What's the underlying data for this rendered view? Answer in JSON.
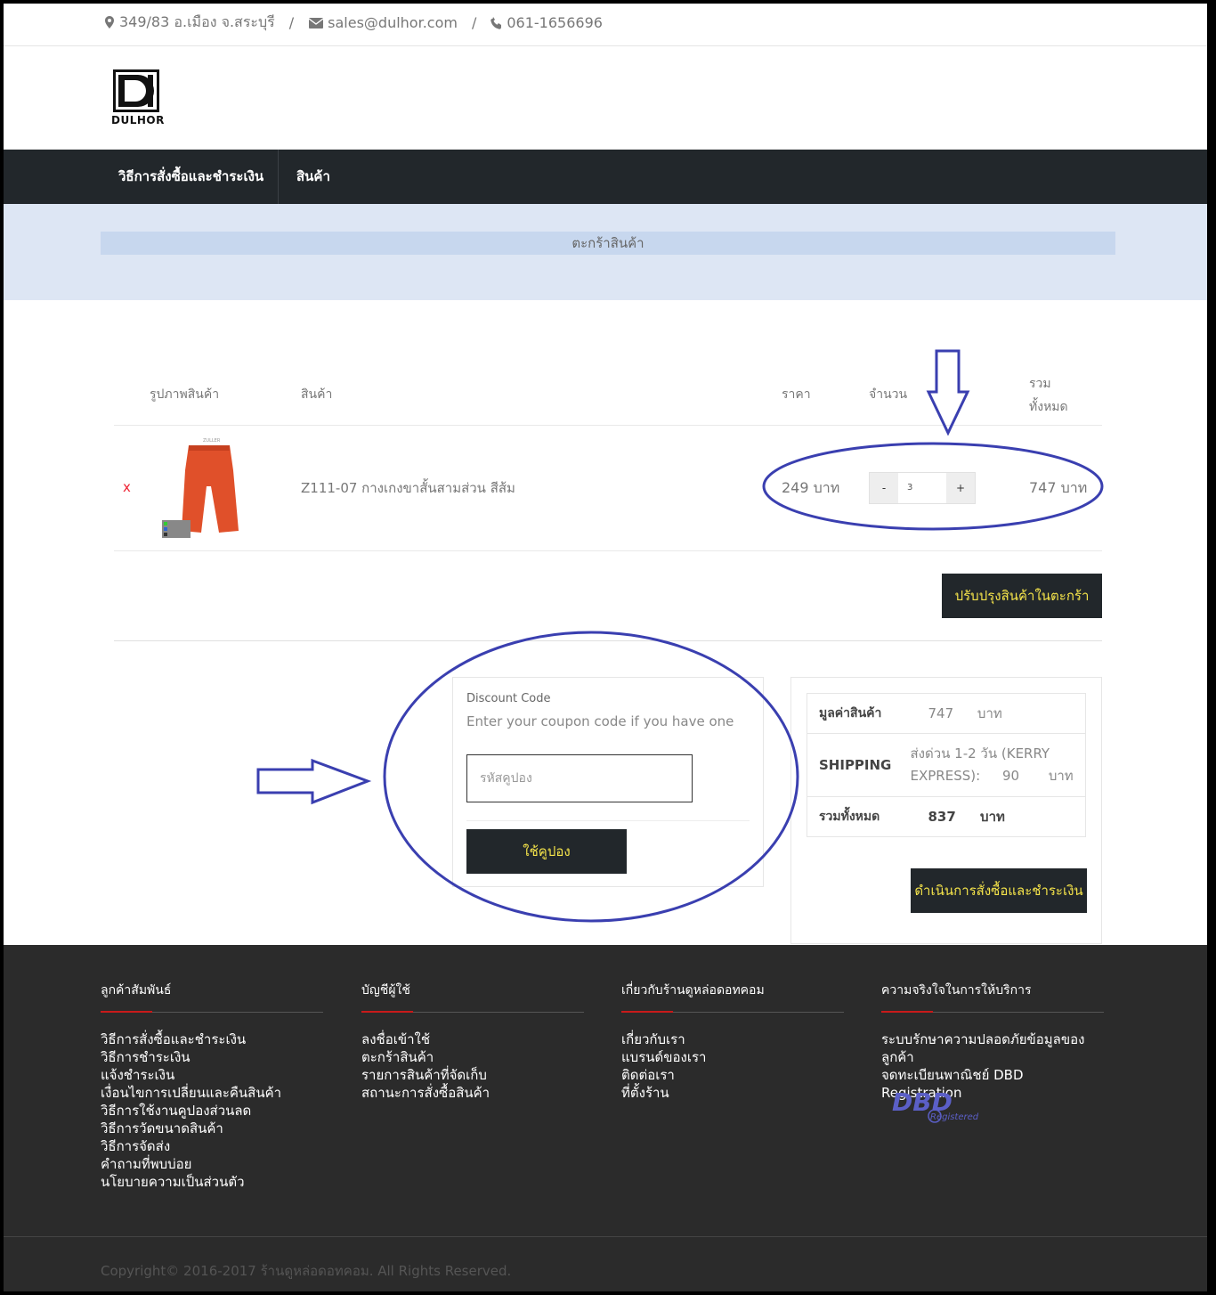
{
  "topbar": {
    "address": "349/83 อ.เมือง จ.สระบุรี",
    "email": "sales@dulhor.com",
    "phone": "061-1656696",
    "separator": "/"
  },
  "logo": {
    "text": "DULHOR"
  },
  "nav": {
    "items": [
      {
        "label": "วิธีการสั่งซื้อและชำระเงิน"
      },
      {
        "label": "สินค้า"
      }
    ]
  },
  "page": {
    "title": "ตะกร้าสินค้า"
  },
  "cart": {
    "headers": {
      "image": "รูปภาพสินค้า",
      "product": "สินค้า",
      "price": "ราคา",
      "quantity": "จำนวน",
      "total_line1": "รวม",
      "total_line2": "ทั้งหมด"
    },
    "items": [
      {
        "remove": "x",
        "name": "Z111-07 กางเกงขาสั้นสามส่วน สีส้ม",
        "price": "249 บาท",
        "quantity": "3",
        "total": "747 บาท",
        "product_color": "#e0502a"
      }
    ],
    "qty_minus": "-",
    "qty_plus": "+",
    "update_button": "ปรับปรุงสินค้าในตะกร้า"
  },
  "discount": {
    "label": "Discount Code",
    "hint": "Enter your coupon code if you have one",
    "placeholder": "รหัสคูปอง",
    "apply_button": "ใช้คูปอง"
  },
  "totals": {
    "subtotal_label": "มูลค่าสินค้า",
    "subtotal_value": "747",
    "shipping_label": "SHIPPING",
    "shipping_value": "ส่งด่วน 1-2 วัน (KERRY EXPRESS):",
    "shipping_amount": "90",
    "grand_label": "รวมทั้งหมด",
    "grand_value": "837",
    "currency": "บาท",
    "checkout_button": "ดำเนินการสั่งซื้อและชำระเงิน"
  },
  "footer": {
    "columns": [
      {
        "title": "ลูกค้าสัมพันธ์",
        "links": [
          "วิธีการสั่งซื้อและชำระเงิน",
          "วิธีการชำระเงิน",
          "แจ้งชำระเงิน",
          "เงื่อนไขการเปลี่ยนและคืนสินค้า",
          "วิธีการใช้งานคูปองส่วนลด",
          "วิธีการวัดขนาดสินค้า",
          "วิธีการจัดส่ง",
          "คำถามที่พบบ่อย",
          "นโยบายความเป็นส่วนตัว"
        ]
      },
      {
        "title": "บัญชีผู้ใช้",
        "links": [
          "ลงชื่อเข้าใช้",
          "ตะกร้าสินค้า",
          "รายการสินค้าที่จัดเก็บ",
          "สถานะการสั่งซื้อสินค้า"
        ]
      },
      {
        "title": "เกี่ยวกับร้านดูหล่อดอทคอม",
        "links": [
          "เกี่ยวกับเรา",
          "แบรนด์ของเรา",
          "ติดต่อเรา",
          "ที่ตั้งร้าน"
        ]
      },
      {
        "title": "ความจริงใจในการให้บริการ",
        "links": [
          "ระบบรักษาความปลอดภัยข้อมูลของลูกค้า",
          "จดทะเบียนพาณิชย์ DBD Registration"
        ]
      }
    ],
    "dbd_logo_text": "DBD",
    "dbd_logo_sub": "Registered",
    "copyright": "Copyright© 2016-2017 ร้านดูหล่อดอทคอม. All Rights Reserved."
  },
  "colors": {
    "nav_bg": "#22272b",
    "button_text": "#f4e34a",
    "band_bg": "#dde6f4",
    "annotation": "#3a3fb0",
    "footer_bg": "#2b2b2b"
  }
}
